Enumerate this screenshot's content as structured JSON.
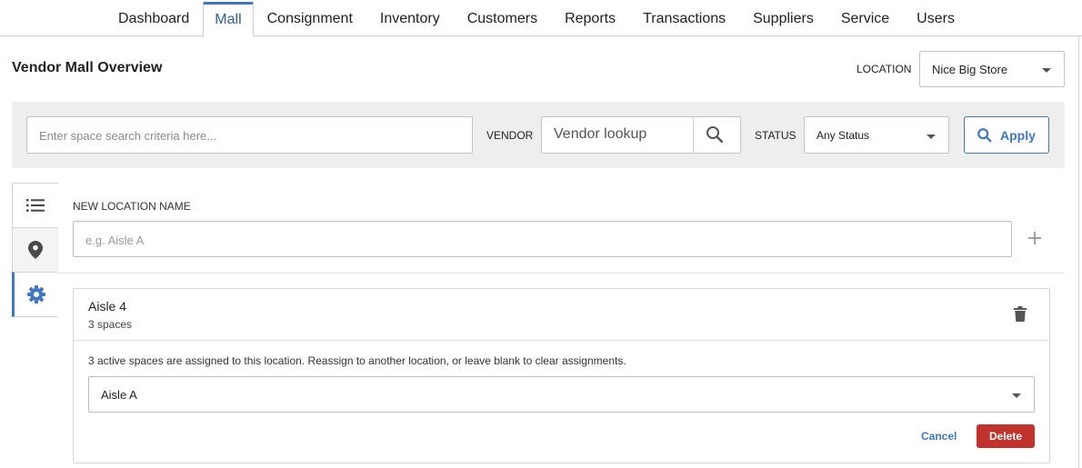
{
  "nav": {
    "tabs": [
      {
        "label": "Dashboard"
      },
      {
        "label": "Mall"
      },
      {
        "label": "Consignment"
      },
      {
        "label": "Inventory"
      },
      {
        "label": "Customers"
      },
      {
        "label": "Reports"
      },
      {
        "label": "Transactions"
      },
      {
        "label": "Suppliers"
      },
      {
        "label": "Service"
      },
      {
        "label": "Users"
      }
    ],
    "active": "Mall"
  },
  "header": {
    "title": "Vendor Mall Overview",
    "location_label": "LOCATION",
    "location_value": "Nice Big Store"
  },
  "filters": {
    "search_placeholder": "Enter space search criteria here...",
    "vendor_label": "VENDOR",
    "vendor_placeholder": "Vendor lookup",
    "status_label": "STATUS",
    "status_value": "Any Status",
    "apply_label": "Apply"
  },
  "side_tabs": {
    "icons": [
      "list-icon",
      "map-pin-icon",
      "gear-icon"
    ],
    "active": "gear-icon"
  },
  "new_location": {
    "label": "NEW LOCATION NAME",
    "placeholder": "e.g. Aisle A"
  },
  "location_card": {
    "name": "Aisle 4",
    "spaces": "3 spaces",
    "message": "3 active spaces are assigned to this location. Reassign to another location, or leave blank to clear assignments.",
    "reassign_value": "Aisle A",
    "cancel_label": "Cancel",
    "delete_label": "Delete"
  },
  "colors": {
    "accent": "#3f78c2",
    "danger": "#c0322b",
    "filter_bg": "#eeeeee"
  }
}
